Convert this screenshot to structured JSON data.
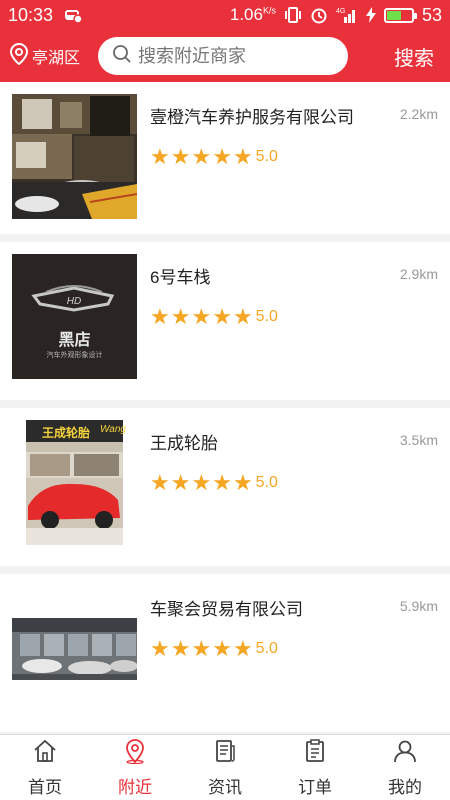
{
  "statusbar": {
    "time": "10:33",
    "speed": "1.06",
    "speed_unit": "K/s",
    "network": "4G",
    "battery": "53"
  },
  "header": {
    "location": "亭湖区",
    "search_placeholder": "搜索附近商家",
    "search_button": "搜索"
  },
  "shops": [
    {
      "name": "壹橙汽车养护服务有限公司",
      "distance": "2.2km",
      "score": "5.0",
      "stars": 5
    },
    {
      "name": "6号车栈",
      "distance": "2.9km",
      "score": "5.0",
      "stars": 5,
      "logo_text": "黑店",
      "logo_sub": "汽车外观形象设计",
      "logo_mark": "HD"
    },
    {
      "name": "王成轮胎",
      "distance": "3.5km",
      "score": "5.0",
      "stars": 5,
      "sign_text": "王成轮胎",
      "sign_brand": "Wang"
    },
    {
      "name": "车聚会贸易有限公司",
      "distance": "5.9km",
      "score": "5.0",
      "stars": 5
    }
  ],
  "tabs": [
    {
      "label": "首页",
      "icon": "home-icon"
    },
    {
      "label": "附近",
      "icon": "location-pin-icon",
      "active": true
    },
    {
      "label": "资讯",
      "icon": "news-icon"
    },
    {
      "label": "订单",
      "icon": "order-clipboard-icon"
    },
    {
      "label": "我的",
      "icon": "user-icon"
    }
  ],
  "colors": {
    "brand_red": "#e8313a",
    "star_orange": "#f5a623"
  }
}
